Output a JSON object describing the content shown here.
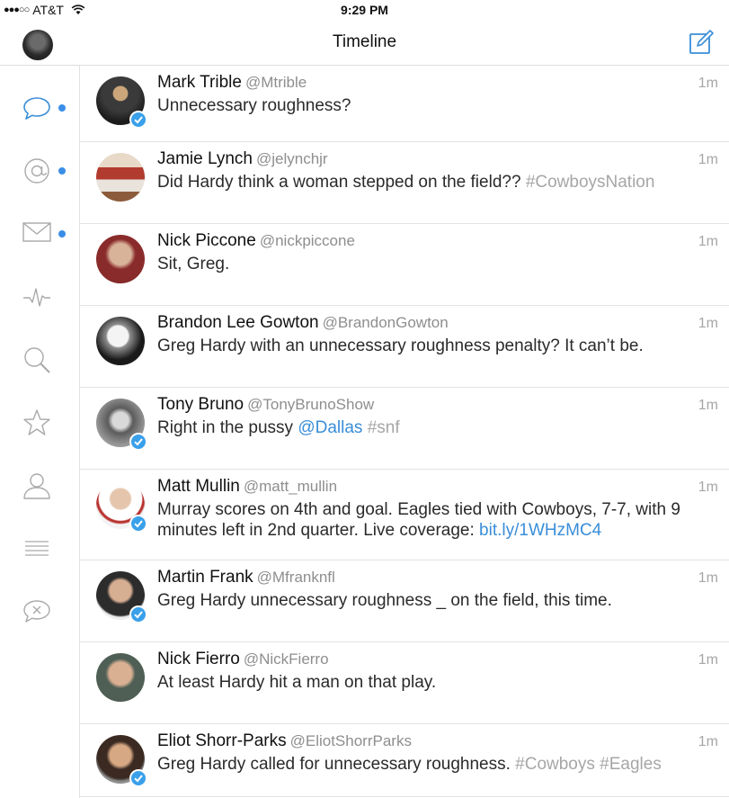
{
  "status_bar": {
    "signal": "●●●○○",
    "carrier": "AT&T",
    "time": "9:29 PM"
  },
  "nav": {
    "title": "Timeline",
    "compose_icon": "compose-icon"
  },
  "sidebar": {
    "items": [
      {
        "icon": "chat-bubble-icon",
        "unread": true
      },
      {
        "icon": "mention-icon",
        "unread": true
      },
      {
        "icon": "envelope-icon",
        "unread": true
      },
      {
        "icon": "activity-icon",
        "unread": false
      },
      {
        "icon": "search-icon",
        "unread": false
      },
      {
        "icon": "star-icon",
        "unread": false
      },
      {
        "icon": "profile-icon",
        "unread": false
      },
      {
        "icon": "lists-icon",
        "unread": false
      },
      {
        "icon": "muted-icon",
        "unread": false
      }
    ]
  },
  "colors": {
    "accent": "#3b8ee6",
    "verified": "#3aa0ea",
    "hashtag": "#a6a6a6"
  },
  "tweets": [
    {
      "name": "Mark Trible",
      "handle": "@Mtrible",
      "time": "1m",
      "verified": true,
      "parts": [
        {
          "t": "text",
          "v": "Unnecessary roughness?"
        }
      ]
    },
    {
      "name": "Jamie Lynch",
      "handle": "@jelynchjr",
      "time": "1m",
      "verified": false,
      "parts": [
        {
          "t": "text",
          "v": "Did Hardy think a woman stepped on the field?? "
        },
        {
          "t": "hashtag",
          "v": "#CowboysNation"
        }
      ]
    },
    {
      "name": "Nick Piccone",
      "handle": "@nickpiccone",
      "time": "1m",
      "verified": false,
      "parts": [
        {
          "t": "text",
          "v": "Sit, Greg."
        }
      ]
    },
    {
      "name": "Brandon Lee Gowton",
      "handle": "@BrandonGowton",
      "time": "1m",
      "verified": false,
      "parts": [
        {
          "t": "text",
          "v": "Greg Hardy with an unnecessary roughness penalty? It can’t be."
        }
      ]
    },
    {
      "name": "Tony Bruno",
      "handle": "@TonyBrunoShow",
      "time": "1m",
      "verified": true,
      "parts": [
        {
          "t": "text",
          "v": "Right in the pussy "
        },
        {
          "t": "mention",
          "v": "@Dallas"
        },
        {
          "t": "text",
          "v": " "
        },
        {
          "t": "hashtag",
          "v": "#snf"
        }
      ]
    },
    {
      "name": "Matt Mullin",
      "handle": "@matt_mullin",
      "time": "1m",
      "verified": true,
      "parts": [
        {
          "t": "text",
          "v": "Murray scores on 4th and goal. Eagles tied with Cowboys, 7-7, with 9 minutes left in 2nd quarter. Live coverage: "
        },
        {
          "t": "link",
          "v": "bit.ly/1WHzMC4"
        }
      ]
    },
    {
      "name": "Martin Frank",
      "handle": "@Mfranknfl",
      "time": "1m",
      "verified": true,
      "parts": [
        {
          "t": "text",
          "v": "Greg Hardy unnecessary roughness _ on the field, this time."
        }
      ]
    },
    {
      "name": "Nick Fierro",
      "handle": "@NickFierro",
      "time": "1m",
      "verified": false,
      "parts": [
        {
          "t": "text",
          "v": "At least Hardy hit a man on that play."
        }
      ]
    },
    {
      "name": "Eliot Shorr-Parks",
      "handle": "@EliotShorrParks",
      "time": "1m",
      "verified": true,
      "parts": [
        {
          "t": "text",
          "v": "Greg Hardy called for unnecessary roughness. "
        },
        {
          "t": "hashtag",
          "v": "#Cowboys"
        },
        {
          "t": "text",
          "v": " "
        },
        {
          "t": "hashtag",
          "v": "#Eagles"
        }
      ]
    }
  ]
}
